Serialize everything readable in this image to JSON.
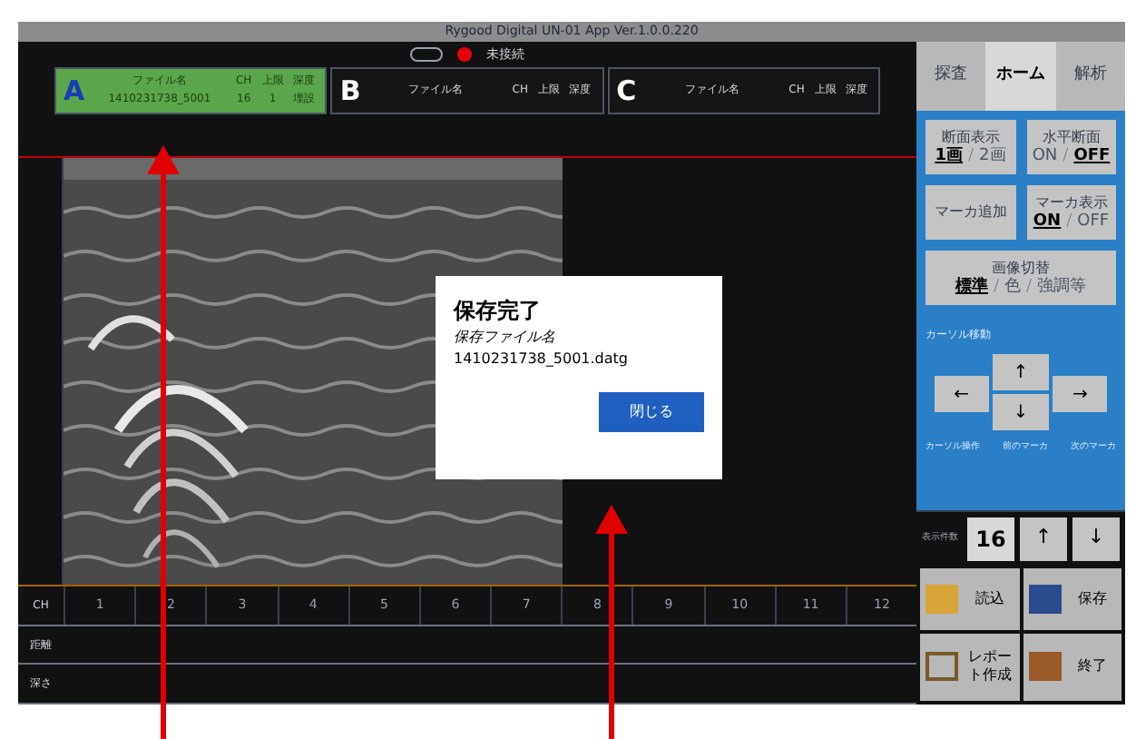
{
  "window": {
    "title": "Rygood Digital UN-01 App Ver.1.0.0.220",
    "status": "未接続",
    "toggle": {
      "on": false
    }
  },
  "slots": [
    {
      "letter": "A",
      "selected": true,
      "headers": [
        "ファイル名",
        "CH",
        "上限",
        "深度"
      ],
      "values": [
        "1410231738_5001",
        "16",
        "1",
        "埋設"
      ]
    },
    {
      "letter": "B",
      "selected": false,
      "headers": [
        "ファイル名",
        "CH",
        "上限",
        "深度"
      ]
    },
    {
      "letter": "C",
      "selected": false,
      "headers": [
        "ファイル名",
        "CH",
        "上限",
        "深度"
      ]
    }
  ],
  "tabs": [
    {
      "label": "探査",
      "selected": false
    },
    {
      "label": "ホーム",
      "selected": true
    },
    {
      "label": "解析",
      "selected": false
    }
  ],
  "panel_buttons": [
    {
      "label": "断面表示",
      "options": [
        {
          "label": "1画",
          "selected": true
        },
        {
          "label": "/",
          "kind": "separator"
        },
        {
          "label": "2画",
          "selected": false
        }
      ]
    },
    {
      "label": "水平断面",
      "options": [
        {
          "label": "ON",
          "selected": false
        },
        {
          "label": "/",
          "kind": "separator"
        },
        {
          "label": "OFF",
          "selected": true
        }
      ]
    },
    {
      "label": "マーカ追加"
    },
    {
      "label": "マーカ表示",
      "options": [
        {
          "label": "ON",
          "selected": true
        },
        {
          "label": "/",
          "kind": "separator"
        },
        {
          "label": "OFF",
          "selected": false
        }
      ]
    },
    {
      "label": "画像切替",
      "options": [
        {
          "label": "標準",
          "selected": true
        },
        {
          "label": "/",
          "kind": "separator"
        },
        {
          "label": "色",
          "selected": false
        },
        {
          "label": "/",
          "kind": "separator"
        },
        {
          "label": "強調等",
          "selected": false
        }
      ]
    }
  ],
  "cursor": {
    "label": "カーソル移動",
    "up": "↑",
    "left": "←",
    "down": "↓",
    "right": "→",
    "footer": [
      "カーソル操作",
      "前のマーカ",
      "次のマーカ"
    ]
  },
  "counter": {
    "label": "表示件数",
    "value": "16",
    "up": "↑",
    "down": "↓"
  },
  "actions": [
    "読込",
    "保存",
    "レポート作成",
    "終了"
  ],
  "table": {
    "row_labels": [
      "CH",
      "距離",
      "深さ"
    ],
    "columns": [
      "1",
      "2",
      "3",
      "4",
      "5",
      "6",
      "7",
      "8",
      "9",
      "10",
      "11",
      "12"
    ]
  },
  "dialog": {
    "title": "保存完了",
    "label": "保存ファイル名",
    "filename": "1410231738_5001.datg",
    "button": "閉じる"
  }
}
